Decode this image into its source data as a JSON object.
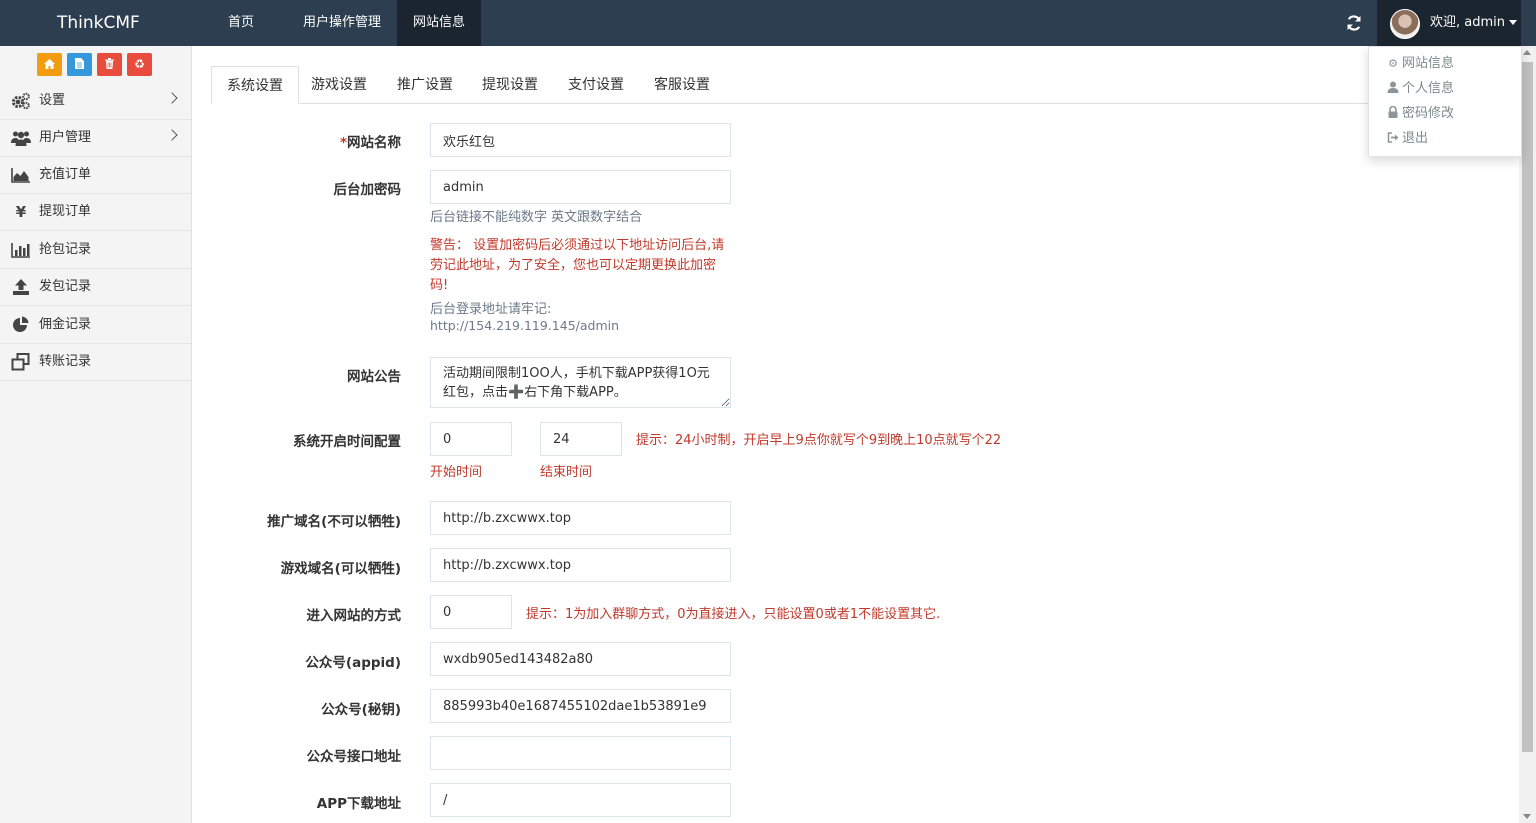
{
  "navbar": {
    "brand": "ThinkCMF",
    "items": [
      {
        "label": "首页",
        "active": false
      },
      {
        "label": "用户操作管理",
        "active": false
      },
      {
        "label": "网站信息",
        "active": true
      }
    ],
    "user_label": "欢迎, admin"
  },
  "user_menu": {
    "items": [
      {
        "label": "网站信息",
        "icon": "gear-icon"
      },
      {
        "label": "个人信息",
        "icon": "user-icon"
      },
      {
        "label": "密码修改",
        "icon": "lock-icon"
      },
      {
        "label": "退出",
        "icon": "sign-out-icon"
      }
    ]
  },
  "quick_buttons": [
    {
      "icon": "home-icon",
      "color": "#f39c12"
    },
    {
      "icon": "file-icon",
      "color": "#3498db"
    },
    {
      "icon": "trash-icon",
      "color": "#e74c3c"
    },
    {
      "icon": "recycle-icon",
      "color": "#e74c3c"
    }
  ],
  "sidebar": {
    "items": [
      {
        "label": "设置",
        "icon": "gears-icon",
        "has_arrow": true
      },
      {
        "label": "用户管理",
        "icon": "users-icon",
        "has_arrow": true
      },
      {
        "label": "充值订单",
        "icon": "area-chart-icon",
        "has_arrow": false
      },
      {
        "label": "提现订单",
        "icon": "yen-icon",
        "has_arrow": false
      },
      {
        "label": "抢包记录",
        "icon": "bar-chart-icon",
        "has_arrow": false
      },
      {
        "label": "发包记录",
        "icon": "upload-icon",
        "has_arrow": false
      },
      {
        "label": "佣金记录",
        "icon": "pie-chart-icon",
        "has_arrow": false
      },
      {
        "label": "转账记录",
        "icon": "clone-icon",
        "has_arrow": false
      }
    ]
  },
  "tabs": [
    {
      "label": "系统设置",
      "active": true
    },
    {
      "label": "游戏设置",
      "active": false
    },
    {
      "label": "推广设置",
      "active": false
    },
    {
      "label": "提现设置",
      "active": false
    },
    {
      "label": "支付设置",
      "active": false
    },
    {
      "label": "客服设置",
      "active": false
    }
  ],
  "form": {
    "site_name": {
      "required_mark": "*",
      "label": "网站名称",
      "value": "欢乐红包"
    },
    "admin_password": {
      "label": "后台加密码",
      "value": "admin",
      "help": "后台链接不能纯数字 英文跟数字结合",
      "warning": "警告： 设置加密码后必须通过以下地址访问后台,请劳记此地址，为了安全，您也可以定期更换此加密码!",
      "login_note": "后台登录地址请牢记:",
      "login_url": "http://154.219.119.145/admin"
    },
    "notice": {
      "label": "网站公告",
      "value": "活动期间限制1OO人，手机下载APP获得1O元红包，点击➕右下角下载APP。"
    },
    "open_time": {
      "label": "系统开启时间配置",
      "start_value": "0",
      "end_value": "24",
      "start_label": "开始时间",
      "end_label": "结束时间",
      "tip": "提示：24小时制，开启早上9点你就写个9到晚上10点就写个22"
    },
    "promo_domain": {
      "label": "推广域名(不可以牺牲)",
      "value": "http://b.zxcwwx.top"
    },
    "game_domain": {
      "label": "游戏域名(可以牺牲)",
      "value": "http://b.zxcwwx.top"
    },
    "entry_mode": {
      "label": "进入网站的方式",
      "value": "0",
      "tip": "提示：1为加入群聊方式，0为直接进入，只能设置0或者1不能设置其它."
    },
    "appid": {
      "label": "公众号(appid)",
      "value": "wxdb905ed143482a80"
    },
    "secret": {
      "label": "公众号(秘钥)",
      "value": "885993b40e1687455102dae1b53891e9"
    },
    "api_url": {
      "label": "公众号接口地址",
      "value": ""
    },
    "app_url": {
      "label": "APP下载地址",
      "value": "/"
    }
  }
}
